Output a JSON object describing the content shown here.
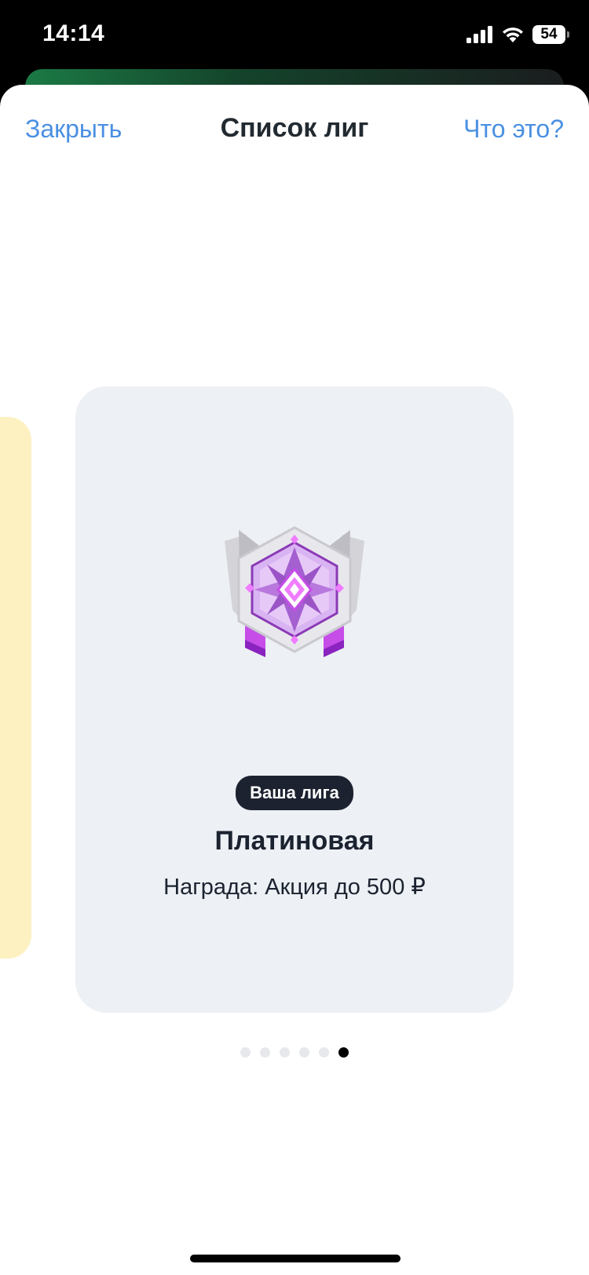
{
  "status_bar": {
    "time": "14:14",
    "battery": "54"
  },
  "header": {
    "close_label": "Закрыть",
    "title": "Список лиг",
    "help_label": "Что это?"
  },
  "league": {
    "badge": "Ваша лига",
    "name": "Платиновая",
    "reward": "Награда: Акция до 500 ₽"
  },
  "pagination": {
    "total": 6,
    "active_index": 5
  },
  "colors": {
    "link": "#4a90e2",
    "card_bg": "#edf0f4",
    "badge_bg": "#1c2230",
    "medal_accent": "#b04fe0"
  }
}
